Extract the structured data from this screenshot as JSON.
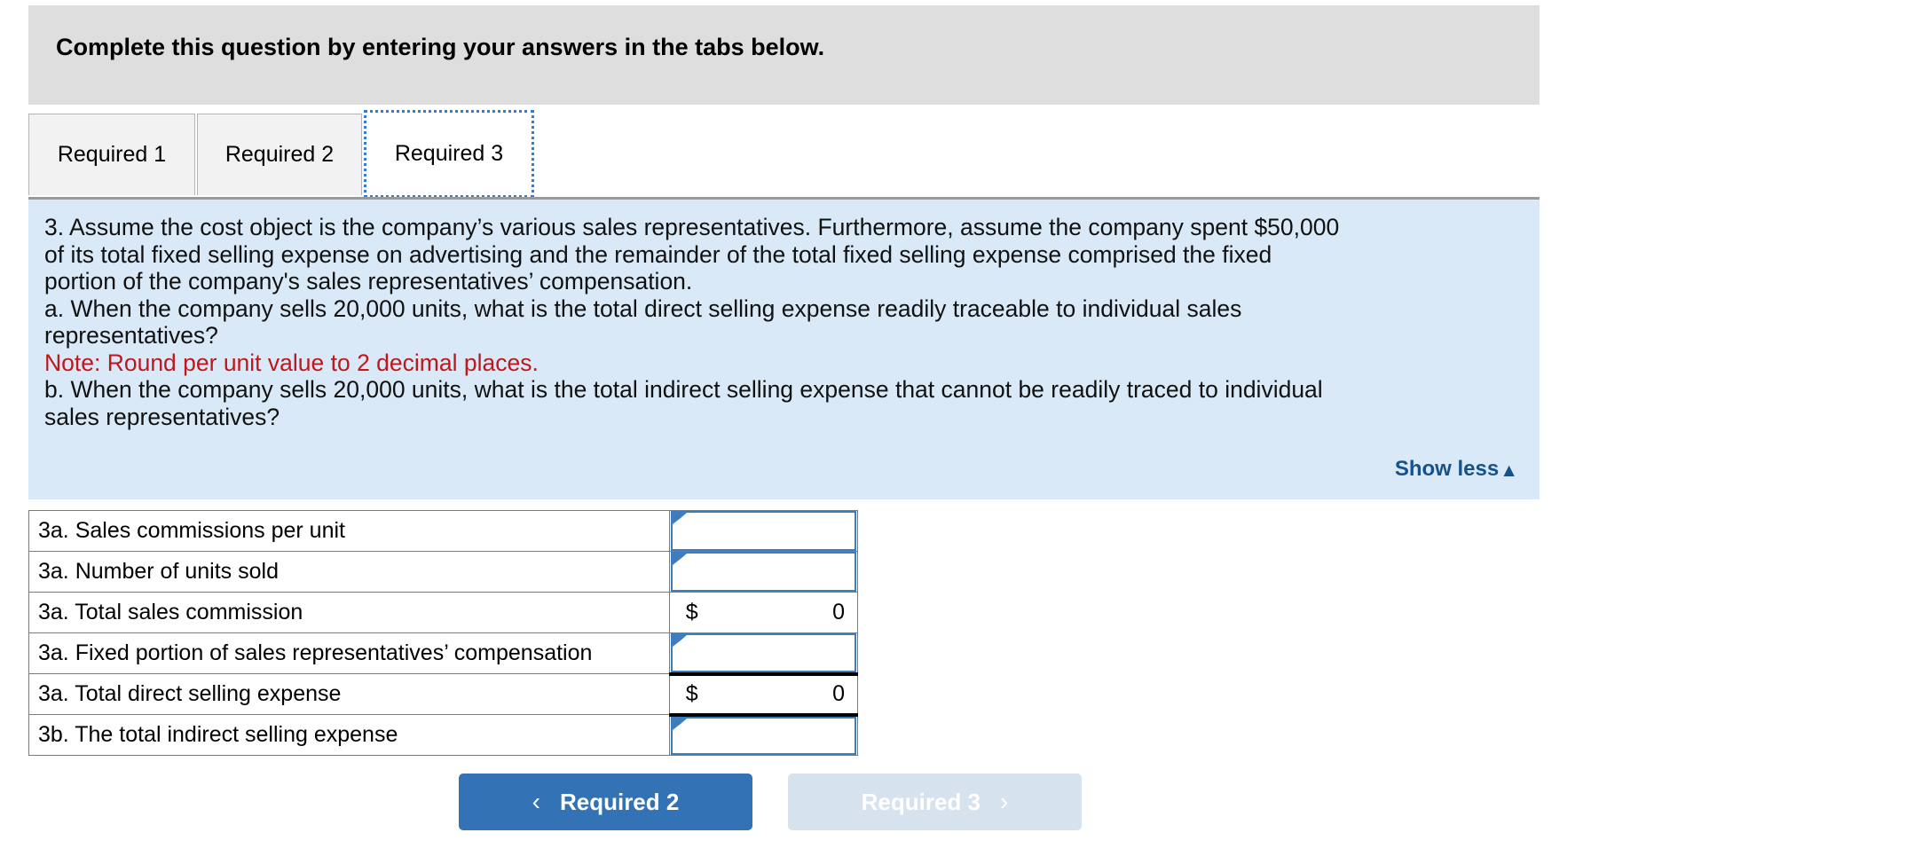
{
  "banner": {
    "text_bold": "Complete this question by entering your answers in the tabs below",
    "text_tail": "."
  },
  "tabs": [
    {
      "label": "Required 1",
      "active": false
    },
    {
      "label": "Required 2",
      "active": false
    },
    {
      "label": "Required 3",
      "active": true
    }
  ],
  "question": {
    "line1": "3. Assume the cost object is the company’s various sales representatives. Furthermore, assume the company spent $50,000",
    "line2": "of its total fixed selling expense on advertising and the remainder of the total fixed selling expense comprised the fixed",
    "line3": "portion of the company's sales representatives’ compensation.",
    "line4": "a. When the company sells 20,000 units, what is the total direct selling expense readily traceable to individual sales",
    "line5": "representatives?",
    "note": "Note: Round per unit value to 2 decimal places.",
    "line6": "b. When the company sells 20,000 units, what is the total indirect selling expense that cannot be readily traced to individual",
    "line7": "sales representatives?",
    "show_less_label": "Show less",
    "show_less_caret": "▲"
  },
  "answer_table": {
    "rows": [
      {
        "label": "3a. Sales commissions per unit",
        "type": "input",
        "value": "",
        "currency": "",
        "amount": ""
      },
      {
        "label": "3a. Number of units sold",
        "type": "input",
        "value": "",
        "currency": "",
        "amount": ""
      },
      {
        "label": "3a. Total sales commission",
        "type": "computed",
        "value": "",
        "currency": "$",
        "amount": "0"
      },
      {
        "label": "3a. Fixed portion of sales representatives’ compensation",
        "type": "input",
        "value": "",
        "currency": "",
        "amount": ""
      },
      {
        "label": "3a. Total direct selling expense",
        "type": "computed",
        "value": "",
        "currency": "$",
        "amount": "0"
      },
      {
        "label": "3b. The total indirect selling expense",
        "type": "input",
        "value": "",
        "currency": "",
        "amount": ""
      }
    ]
  },
  "nav": {
    "prev_label": "Required 2",
    "prev_chevron": "‹",
    "next_label": "Required 3",
    "next_chevron": "›"
  },
  "colors": {
    "banner_bg": "#dedede",
    "panel_bg": "#d9e9f7",
    "accent_blue": "#3d7dbf",
    "link_blue": "#15528c",
    "note_red": "#c0171c",
    "btn_active": "#3372b4",
    "btn_disabled": "#d7e2ef"
  }
}
